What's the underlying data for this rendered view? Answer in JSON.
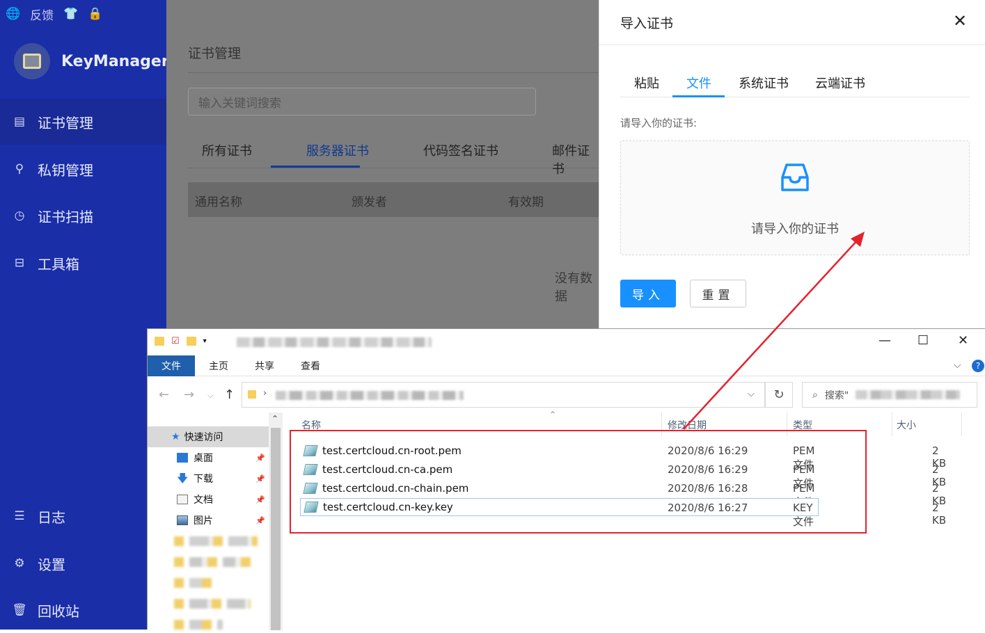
{
  "sidebar": {
    "top_feedback": "反馈",
    "brand": "KeyManager",
    "items": [
      {
        "label": "证书管理",
        "icon": "certificate-icon",
        "active": true
      },
      {
        "label": "私钥管理",
        "icon": "key-icon",
        "active": false
      },
      {
        "label": "证书扫描",
        "icon": "scan-clock-icon",
        "active": false
      },
      {
        "label": "工具箱",
        "icon": "toolbox-icon",
        "active": false
      },
      {
        "label": "日志",
        "icon": "log-icon",
        "active": false
      },
      {
        "label": "设置",
        "icon": "gear-icon",
        "active": false
      },
      {
        "label": "回收站",
        "icon": "trash-icon",
        "active": false
      }
    ]
  },
  "main": {
    "title": "证书管理",
    "search_placeholder": "输入关键词搜索",
    "tabs": [
      "所有证书",
      "服务器证书",
      "代码签名证书",
      "邮件证书"
    ],
    "active_tab": "服务器证书",
    "columns": [
      "通用名称",
      "颁发者",
      "有效期"
    ],
    "empty_text": "没有数据"
  },
  "drawer": {
    "title": "导入证书",
    "close": "✕",
    "tabs": [
      "粘贴",
      "文件",
      "系统证书",
      "云端证书"
    ],
    "active_tab": "文件",
    "hint": "请导入你的证书:",
    "drop_text": "请导入你的证书",
    "import_button": "导入",
    "reset_button": "重置"
  },
  "explorer": {
    "ribbon_tabs": [
      "文件",
      "主页",
      "共享",
      "查看"
    ],
    "search_prefix": "搜索\"",
    "quick_access": "快速访问",
    "nav_items": [
      {
        "label": "桌面",
        "icon": "desktop-icon"
      },
      {
        "label": "下载",
        "icon": "download-icon"
      },
      {
        "label": "文档",
        "icon": "document-icon"
      },
      {
        "label": "图片",
        "icon": "picture-icon"
      }
    ],
    "columns": [
      "名称",
      "修改日期",
      "类型",
      "大小"
    ],
    "files": [
      {
        "name": "test.certcloud.cn-root.pem",
        "modified": "2020/8/6 16:29",
        "type": "PEM 文件",
        "size": "2 KB"
      },
      {
        "name": "test.certcloud.cn-ca.pem",
        "modified": "2020/8/6 16:29",
        "type": "PEM 文件",
        "size": "2 KB"
      },
      {
        "name": "test.certcloud.cn-chain.pem",
        "modified": "2020/8/6 16:28",
        "type": "PEM 文件",
        "size": "2 KB"
      },
      {
        "name": "test.certcloud.cn-key.key",
        "modified": "2020/8/6 16:27",
        "type": "KEY 文件",
        "size": "2 KB"
      }
    ]
  },
  "colors": {
    "sidebar_bg": "#1a2ea8",
    "accent": "#1890ff",
    "annotation_red": "#e5212b"
  }
}
